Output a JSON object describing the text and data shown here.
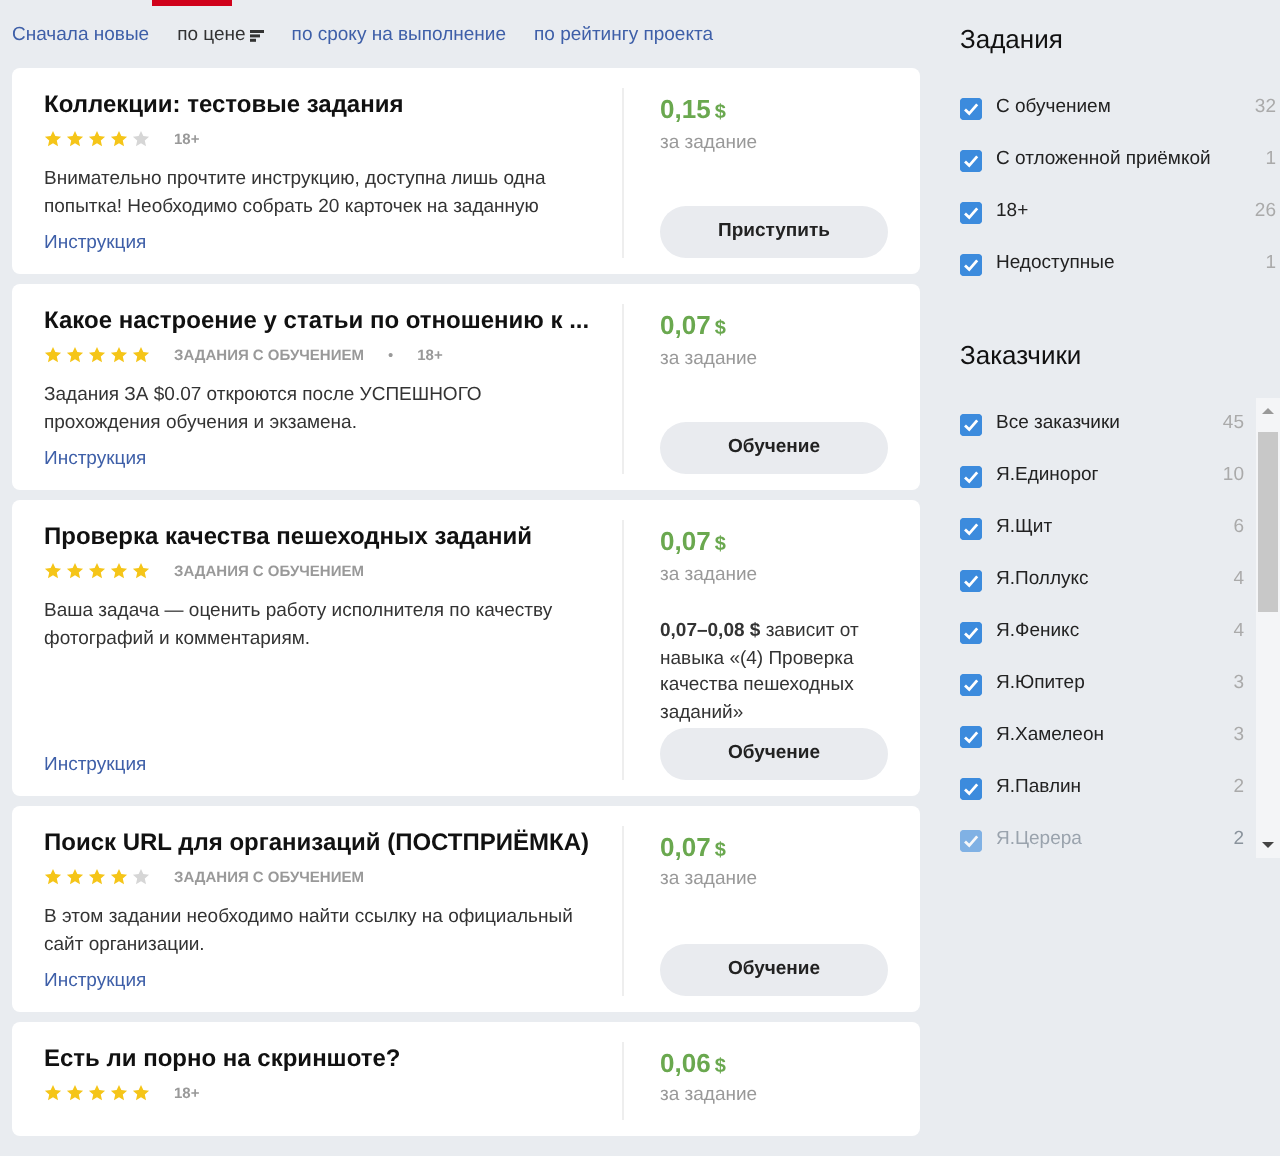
{
  "sort_options": [
    {
      "label": "Сначала новые",
      "selected": false,
      "sort_icon": false
    },
    {
      "label": "по цене",
      "selected": true,
      "sort_icon": true
    },
    {
      "label": "по сроку на выполнение",
      "selected": false,
      "sort_icon": false
    },
    {
      "label": "по рейтингу проекта",
      "selected": false,
      "sort_icon": false
    }
  ],
  "tasks": [
    {
      "title": "Коллекции: тестовые задания",
      "stars": 4,
      "tags": [
        "18+"
      ],
      "description": "Внимательно прочтите инструкцию, доступна лишь одна попытка! Необходимо собрать 20 карточек на заданную",
      "instruction_link": "Инструкция",
      "price": "0,15",
      "currency": "$",
      "price_unit": "за задание",
      "button": "Приступить"
    },
    {
      "title": "Какое настроение у статьи по отношению к ...",
      "stars": 5,
      "tags": [
        "ЗАДАНИЯ С ОБУЧЕНИЕМ",
        "18+"
      ],
      "tag_separator": "•",
      "description": "Задания ЗА $0.07 откроются после УСПЕШНОГО прохождения обучения и экзамена.",
      "instruction_link": "Инструкция",
      "price": "0,07",
      "currency": "$",
      "price_unit": "за задание",
      "button": "Обучение"
    },
    {
      "title": "Проверка качества пешеходных заданий",
      "stars": 5,
      "tags": [
        "ЗАДАНИЯ С ОБУЧЕНИЕМ"
      ],
      "description": "Ваша задача — оценить работу исполнителя по качеству фотографий и комментариям.",
      "instruction_link": "Инструкция",
      "price": "0,07",
      "currency": "$",
      "price_unit": "за задание",
      "price_note": "**0,07–0,08 $** зависит от навыка «(4) Проверка качества пешеходных заданий»",
      "button": "Обучение"
    },
    {
      "title": "Поиск URL для организаций (ПОСТПРИЁМКА)",
      "stars": 4,
      "tags": [
        "ЗАДАНИЯ С ОБУЧЕНИЕМ"
      ],
      "description": "В этом задании необходимо найти ссылку на официальный сайт организации.",
      "instruction_link": "Инструкция",
      "price": "0,07",
      "currency": "$",
      "price_unit": "за задание",
      "button": "Обучение"
    },
    {
      "title": "Есть ли порно на скриншоте?",
      "stars": 5,
      "tags": [
        "18+"
      ],
      "price": "0,06",
      "currency": "$",
      "price_unit": "за задание"
    }
  ],
  "filters": {
    "title": "Задания",
    "items": [
      {
        "label": "С обучением",
        "count": "32",
        "checked": true
      },
      {
        "label": "С отложенной приёмкой",
        "count": "1",
        "checked": true
      },
      {
        "label": "18+",
        "count": "26",
        "checked": true
      },
      {
        "label": "Недоступные",
        "count": "1",
        "checked": true
      }
    ]
  },
  "customers": {
    "title": "Заказчики",
    "items": [
      {
        "label": "Все заказчики",
        "count": "45",
        "checked": true,
        "faded": false
      },
      {
        "label": "Я.Единорог",
        "count": "10",
        "checked": true,
        "faded": false
      },
      {
        "label": "Я.Щит",
        "count": "6",
        "checked": true,
        "faded": false
      },
      {
        "label": "Я.Поллукс",
        "count": "4",
        "checked": true,
        "faded": false
      },
      {
        "label": "Я.Феникс",
        "count": "4",
        "checked": true,
        "faded": false
      },
      {
        "label": "Я.Юпитер",
        "count": "3",
        "checked": true,
        "faded": false
      },
      {
        "label": "Я.Хамелеон",
        "count": "3",
        "checked": true,
        "faded": false
      },
      {
        "label": "Я.Павлин",
        "count": "2",
        "checked": true,
        "faded": false
      },
      {
        "label": "Я.Церера",
        "count": "2",
        "checked": true,
        "faded": true
      }
    ]
  }
}
